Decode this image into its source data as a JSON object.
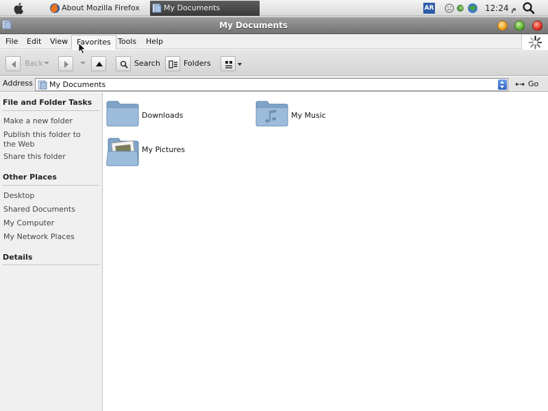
{
  "taskbar": {
    "tasks": [
      {
        "label": "About Mozilla Firefox",
        "icon": "firefox-icon"
      },
      {
        "label": "My Documents",
        "icon": "folder-icon",
        "active": true
      }
    ],
    "language": "AR",
    "clock": "12:24 م"
  },
  "window": {
    "title": "My Documents"
  },
  "menu": {
    "file": "File",
    "edit": "Edit",
    "view": "View",
    "favorites": "Favorites",
    "tools": "Tools",
    "help": "Help"
  },
  "toolbar": {
    "back": "Back",
    "search": "Search",
    "folders": "Folders"
  },
  "address": {
    "label": "Address",
    "value": "My Documents",
    "go": "Go"
  },
  "taskpane": {
    "sections": [
      {
        "title": "File and Folder Tasks",
        "links": [
          "Make a new folder",
          "Publish this folder to the Web",
          "Share this folder"
        ]
      },
      {
        "title": "Other Places",
        "links": [
          "Desktop",
          "Shared Documents",
          "My Computer",
          "My Network Places"
        ]
      },
      {
        "title": "Details",
        "links": []
      }
    ]
  },
  "items": [
    {
      "label": "Downloads",
      "icon": "folder-icon"
    },
    {
      "label": "My Music",
      "icon": "music-folder-icon"
    },
    {
      "label": "My Pictures",
      "icon": "pictures-folder-icon"
    }
  ],
  "colors": {
    "folder": "#8fb2d4",
    "titlebar": "#7f7f7f",
    "accent": "#2c5cc0"
  }
}
